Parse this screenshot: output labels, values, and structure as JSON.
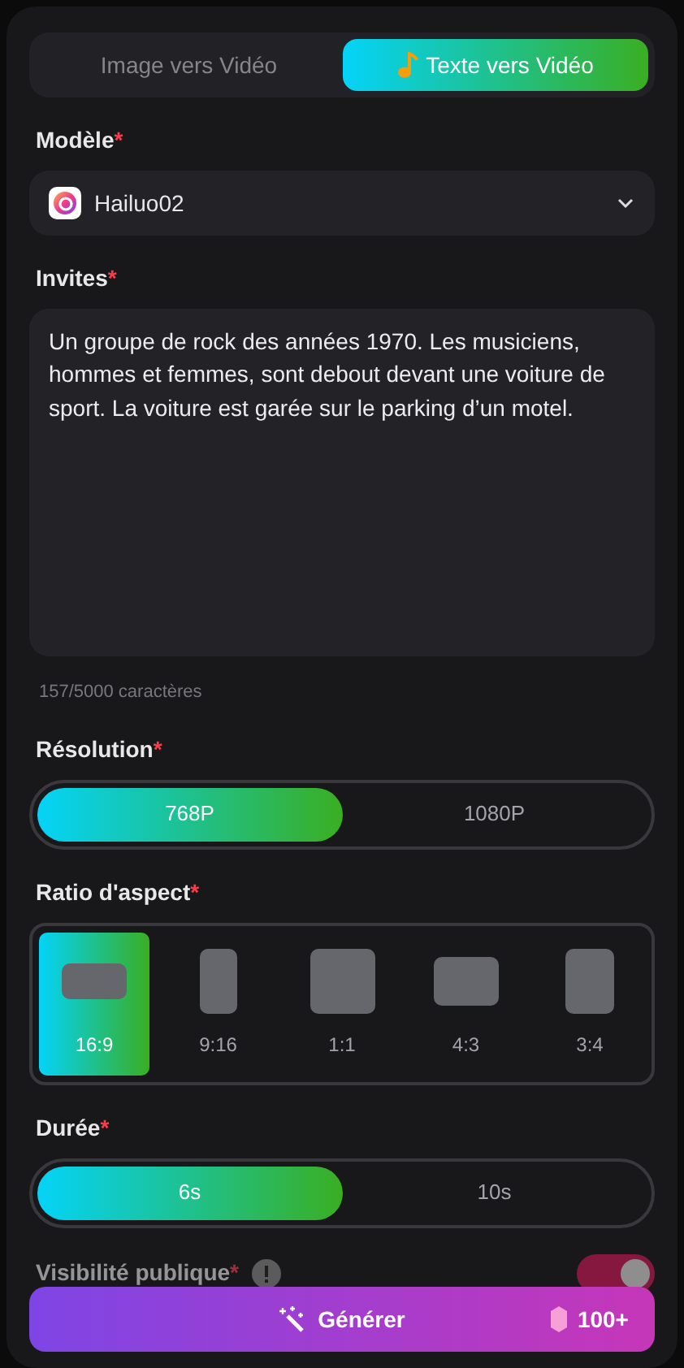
{
  "mode_tabs": [
    {
      "label": "Image vers Vidéo",
      "selected": false,
      "icon": false
    },
    {
      "label": "Texte vers Vidéo",
      "selected": true,
      "icon": true
    }
  ],
  "model": {
    "label": "Modèle",
    "required": "*",
    "value": "Hailuo02"
  },
  "prompt": {
    "label": "Invites",
    "required": "*",
    "value": "Un groupe de rock des années 1970. Les musiciens, hommes et femmes, sont debout devant une voiture de sport. La voiture est garée sur le parking d’un motel.",
    "counter": "157/5000 caractères"
  },
  "resolution": {
    "label": "Résolution",
    "required": "*",
    "options": [
      {
        "label": "768P",
        "selected": true
      },
      {
        "label": "1080P",
        "selected": false
      }
    ]
  },
  "aspect_ratio": {
    "label": "Ratio d'aspect",
    "required": "*",
    "options": [
      {
        "label": "16:9",
        "selected": true
      },
      {
        "label": "9:16",
        "selected": false
      },
      {
        "label": "1:1",
        "selected": false
      },
      {
        "label": "4:3",
        "selected": false
      },
      {
        "label": "3:4",
        "selected": false
      }
    ]
  },
  "duration": {
    "label": "Durée",
    "required": "*",
    "options": [
      {
        "label": "6s",
        "selected": true
      },
      {
        "label": "10s",
        "selected": false
      }
    ]
  },
  "public_visibility": {
    "label": "Visibilité publique",
    "required": "*",
    "on": true
  },
  "generate_button": {
    "label": "Générer",
    "cost": "100+"
  }
}
